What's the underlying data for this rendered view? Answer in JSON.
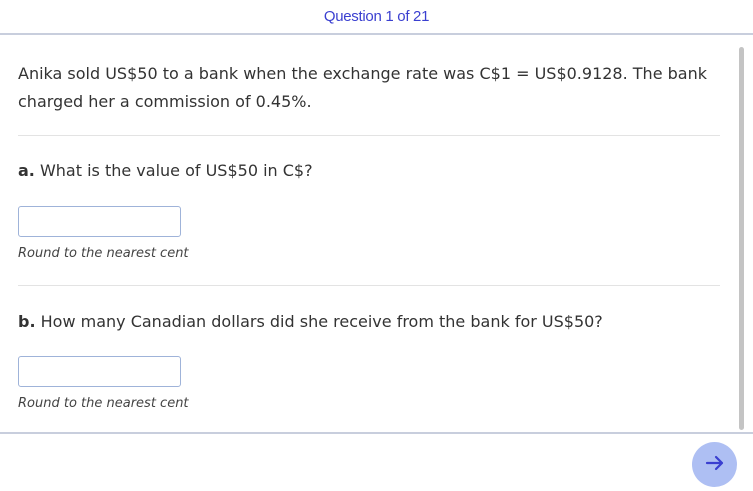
{
  "header": {
    "title": "Question 1 of 21"
  },
  "question": {
    "prompt": "Anika sold US$50 to a bank when the exchange rate was C$1 = US$0.9128. The bank charged her a commission of 0.45%."
  },
  "parts": [
    {
      "letter": "a.",
      "text": " What is the value of US$50 in C$?",
      "answer_value": "",
      "hint": "Round to the nearest cent"
    },
    {
      "letter": "b.",
      "text": " How many Canadian dollars did she receive from the bank for US$50?",
      "answer_value": "",
      "hint": "Round to the nearest cent"
    }
  ],
  "footer": {
    "next_icon": "arrow-right-icon"
  },
  "colors": {
    "accent": "#3a3fd0",
    "next_button_bg": "#aebff3",
    "input_border": "#9fb3d9",
    "divider": "#c8cedd"
  }
}
